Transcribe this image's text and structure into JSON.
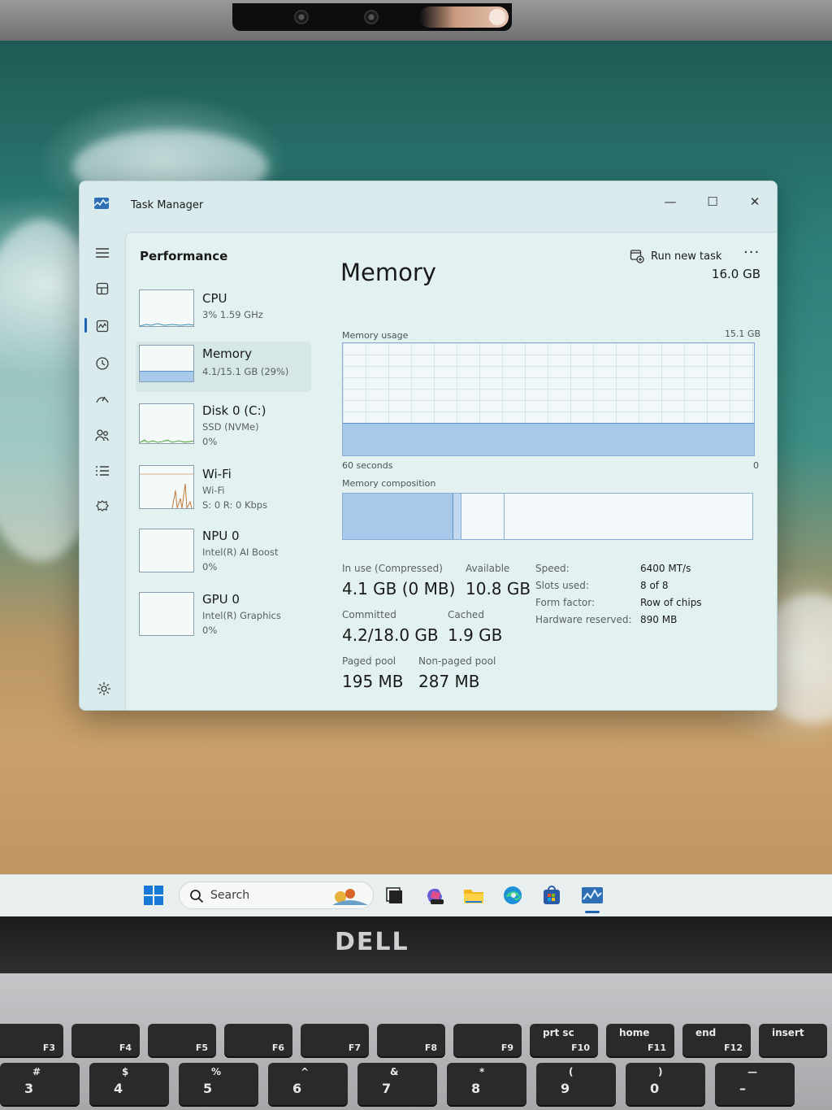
{
  "window": {
    "title": "Task Manager",
    "controls": {
      "minimize": "—",
      "maximize": "☐",
      "close": "✕"
    }
  },
  "header": {
    "page_title": "Performance",
    "run_new_task": "Run new task",
    "more": "···"
  },
  "devices": [
    {
      "name": "CPU",
      "line1": "3%  1.59 GHz",
      "line2": ""
    },
    {
      "name": "Memory",
      "line1": "4.1/15.1 GB (29%)",
      "line2": ""
    },
    {
      "name": "Disk 0 (C:)",
      "line1": "SSD (NVMe)",
      "line2": "0%"
    },
    {
      "name": "Wi-Fi",
      "line1": "Wi-Fi",
      "line2": "S: 0 R: 0 Kbps"
    },
    {
      "name": "NPU 0",
      "line1": "Intel(R) AI Boost",
      "line2": "0%"
    },
    {
      "name": "GPU 0",
      "line1": "Intel(R) Graphics",
      "line2": "0%"
    }
  ],
  "memory": {
    "heading": "Memory",
    "total": "16.0 GB",
    "usage_label": "Memory usage",
    "usage_max": "15.1 GB",
    "time_left": "60 seconds",
    "time_right": "0",
    "composition_label": "Memory composition",
    "usage_fraction": 0.29,
    "composition": {
      "in_use": 0.27,
      "modified": 0.02,
      "standby": 0.105
    },
    "stats": {
      "in_use_label": "In use (Compressed)",
      "in_use_value": "4.1 GB (0 MB)",
      "available_label": "Available",
      "available_value": "10.8 GB",
      "committed_label": "Committed",
      "committed_value": "4.2/18.0 GB",
      "cached_label": "Cached",
      "cached_value": "1.9 GB",
      "paged_label": "Paged pool",
      "paged_value": "195 MB",
      "nonpaged_label": "Non-paged pool",
      "nonpaged_value": "287 MB"
    },
    "specs": [
      {
        "label": "Speed:",
        "value": "6400 MT/s"
      },
      {
        "label": "Slots used:",
        "value": "8 of 8"
      },
      {
        "label": "Form factor:",
        "value": "Row of chips"
      },
      {
        "label": "Hardware reserved:",
        "value": "890 MB"
      }
    ]
  },
  "taskbar": {
    "search_label": "Search"
  },
  "hardware": {
    "logo": "DELL",
    "fn_keys": [
      {
        "top": "",
        "bottom": "F3"
      },
      {
        "top": "",
        "bottom": "F4"
      },
      {
        "top": "",
        "bottom": "F5"
      },
      {
        "top": "",
        "bottom": "F6"
      },
      {
        "top": "",
        "bottom": "F7"
      },
      {
        "top": "",
        "bottom": "F8"
      },
      {
        "top": "",
        "bottom": "F9"
      },
      {
        "top": "prt sc",
        "bottom": "F10"
      },
      {
        "top": "home",
        "bottom": "F11"
      },
      {
        "top": "end",
        "bottom": "F12"
      },
      {
        "top": "insert",
        "bottom": ""
      }
    ],
    "num_keys": [
      {
        "top": "#",
        "main": "3"
      },
      {
        "top": "$",
        "main": "4"
      },
      {
        "top": "%",
        "main": "5"
      },
      {
        "top": "^",
        "main": "6"
      },
      {
        "top": "&",
        "main": "7"
      },
      {
        "top": "*",
        "main": "8"
      },
      {
        "top": "(",
        "main": "9"
      },
      {
        "top": ")",
        "main": "0"
      },
      {
        "top": "—",
        "main": "–"
      }
    ]
  },
  "colors": {
    "accent": "#1e62b4",
    "memory_fill": "#a9c9ea",
    "memory_line": "#5f8fc4",
    "window_bg": "#d9ebec"
  }
}
